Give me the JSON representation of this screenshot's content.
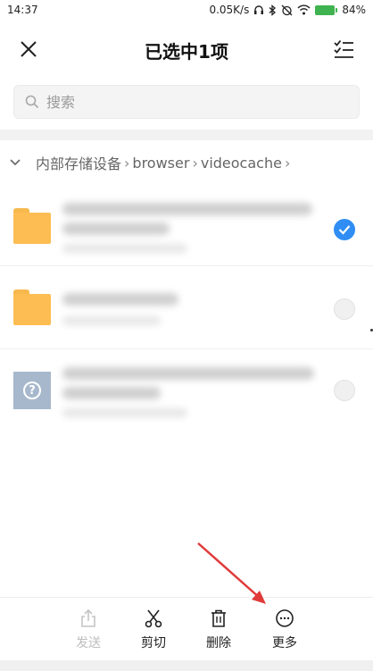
{
  "status_bar": {
    "time": "14:37",
    "net_speed": "0.05K/s",
    "battery": "84%"
  },
  "header": {
    "title": "已选中1项",
    "close_icon": "close-icon",
    "select_all_icon": "checklist-icon"
  },
  "search": {
    "placeholder": "搜索",
    "value": ""
  },
  "breadcrumb": {
    "segments": [
      "内部存储设备",
      "browser",
      "videocache"
    ]
  },
  "files": [
    {
      "type": "folder",
      "selected": true,
      "name_obscured": true
    },
    {
      "type": "folder",
      "selected": false,
      "name_obscured": true
    },
    {
      "type": "unknown",
      "selected": false,
      "name_obscured": true
    }
  ],
  "actions": {
    "send": "发送",
    "cut": "剪切",
    "delete": "删除",
    "more": "更多"
  },
  "colors": {
    "accent": "#2f8df4",
    "folder": "#fdbd52",
    "unknown_file": "#a7b8cc",
    "battery": "#3fb34f",
    "annotation_arrow": "#e03a3a"
  }
}
